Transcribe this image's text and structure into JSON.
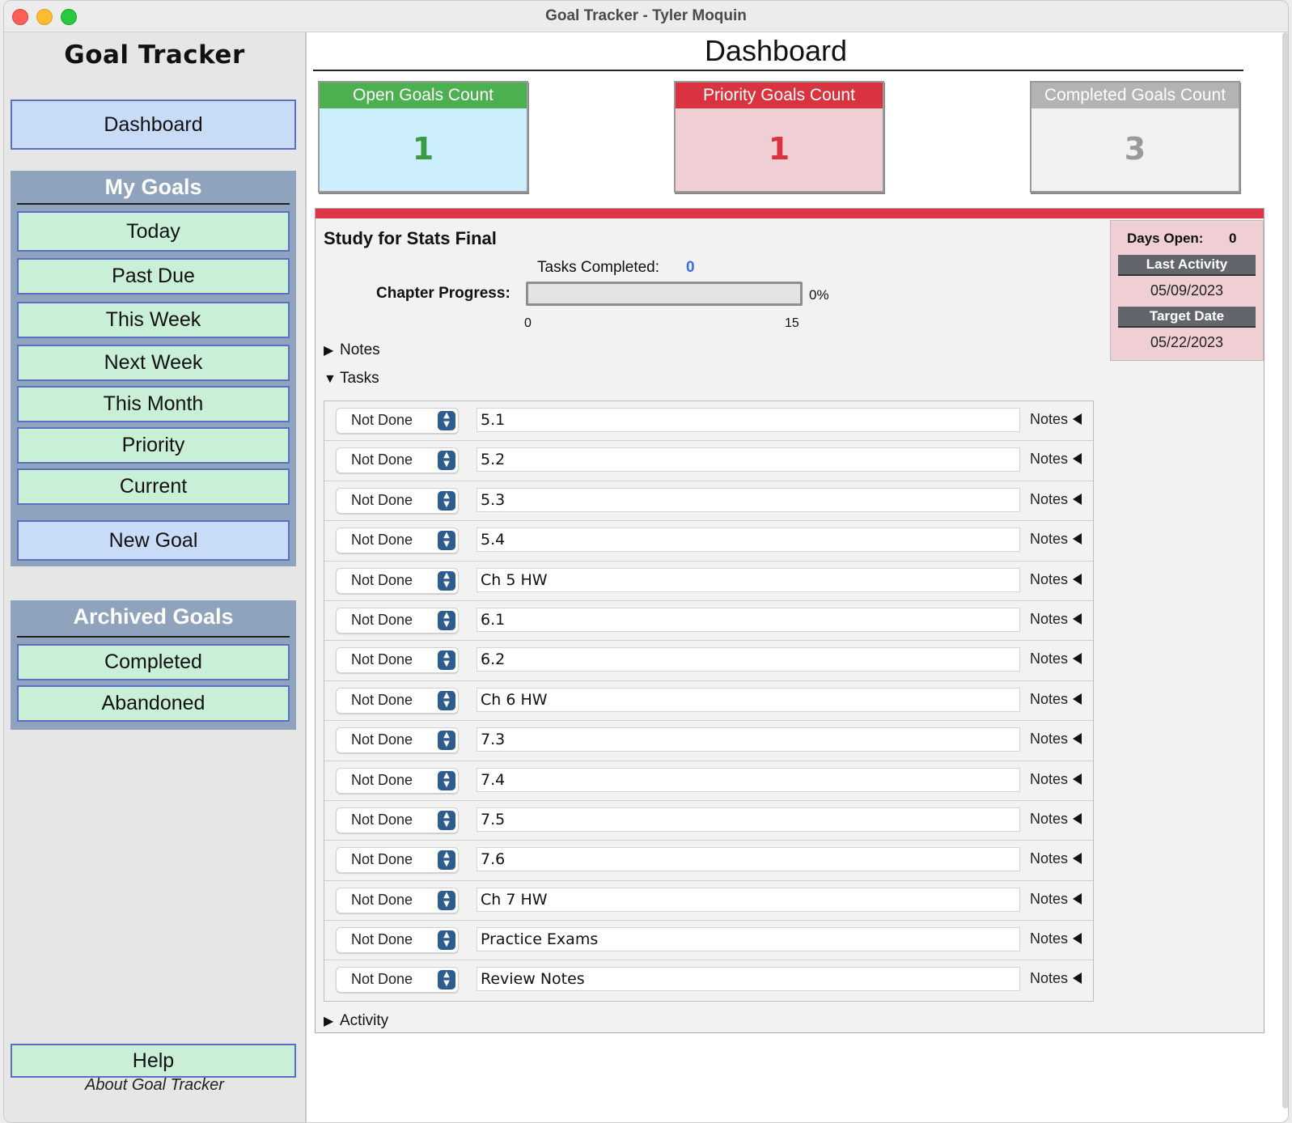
{
  "window": {
    "title": "Goal Tracker - Tyler Moquin"
  },
  "sidebar": {
    "app_title": "Goal Tracker",
    "dashboard_label": "Dashboard",
    "my_goals": {
      "title": "My Goals",
      "items": [
        "Today",
        "Past Due",
        "This Week",
        "Next Week",
        "This Month",
        "Priority",
        "Current"
      ],
      "new_goal": "New Goal"
    },
    "archived": {
      "title": "Archived Goals",
      "items": [
        "Completed",
        "Abandoned"
      ]
    },
    "help_label": "Help",
    "about_label": "About Goal Tracker"
  },
  "main": {
    "title": "Dashboard",
    "counts": [
      {
        "label": "Open Goals Count",
        "value": "1",
        "head_color": "#4caf50",
        "body_color": "#ccedfb",
        "value_color": "#3a9a45"
      },
      {
        "label": "Priority Goals Count",
        "value": "1",
        "head_color": "#d8333f",
        "body_color": "#efcfd3",
        "value_color": "#d8333f"
      },
      {
        "label": "Completed Goals Count",
        "value": "3",
        "head_color": "#b3b3b3",
        "body_color": "#f2f2f2",
        "value_color": "#9a9a9a"
      }
    ],
    "goal": {
      "name": "Study for Stats Final",
      "tasks_completed_label": "Tasks Completed:",
      "tasks_completed_value": "0",
      "chapter_progress_label": "Chapter Progress:",
      "progress_percent": "0%",
      "progress_value": 0,
      "progress_min": "0",
      "progress_max": "15",
      "days_open_label": "Days Open:",
      "days_open_value": "0",
      "last_activity_label": "Last Activity",
      "last_activity_value": "05/09/2023",
      "target_date_label": "Target Date",
      "target_date_value": "05/22/2023",
      "notes_section": "Notes",
      "tasks_section": "Tasks",
      "activity_section": "Activity",
      "task_status_default": "Not Done",
      "task_notes_label": "Notes",
      "tasks": [
        "5.1",
        "5.2",
        "5.3",
        "5.4",
        "Ch 5 HW",
        "6.1",
        "6.2",
        "Ch 6 HW",
        "7.3",
        "7.4",
        "7.5",
        "7.6",
        "Ch 7 HW",
        "Practice Exams",
        "Review Notes"
      ]
    }
  }
}
